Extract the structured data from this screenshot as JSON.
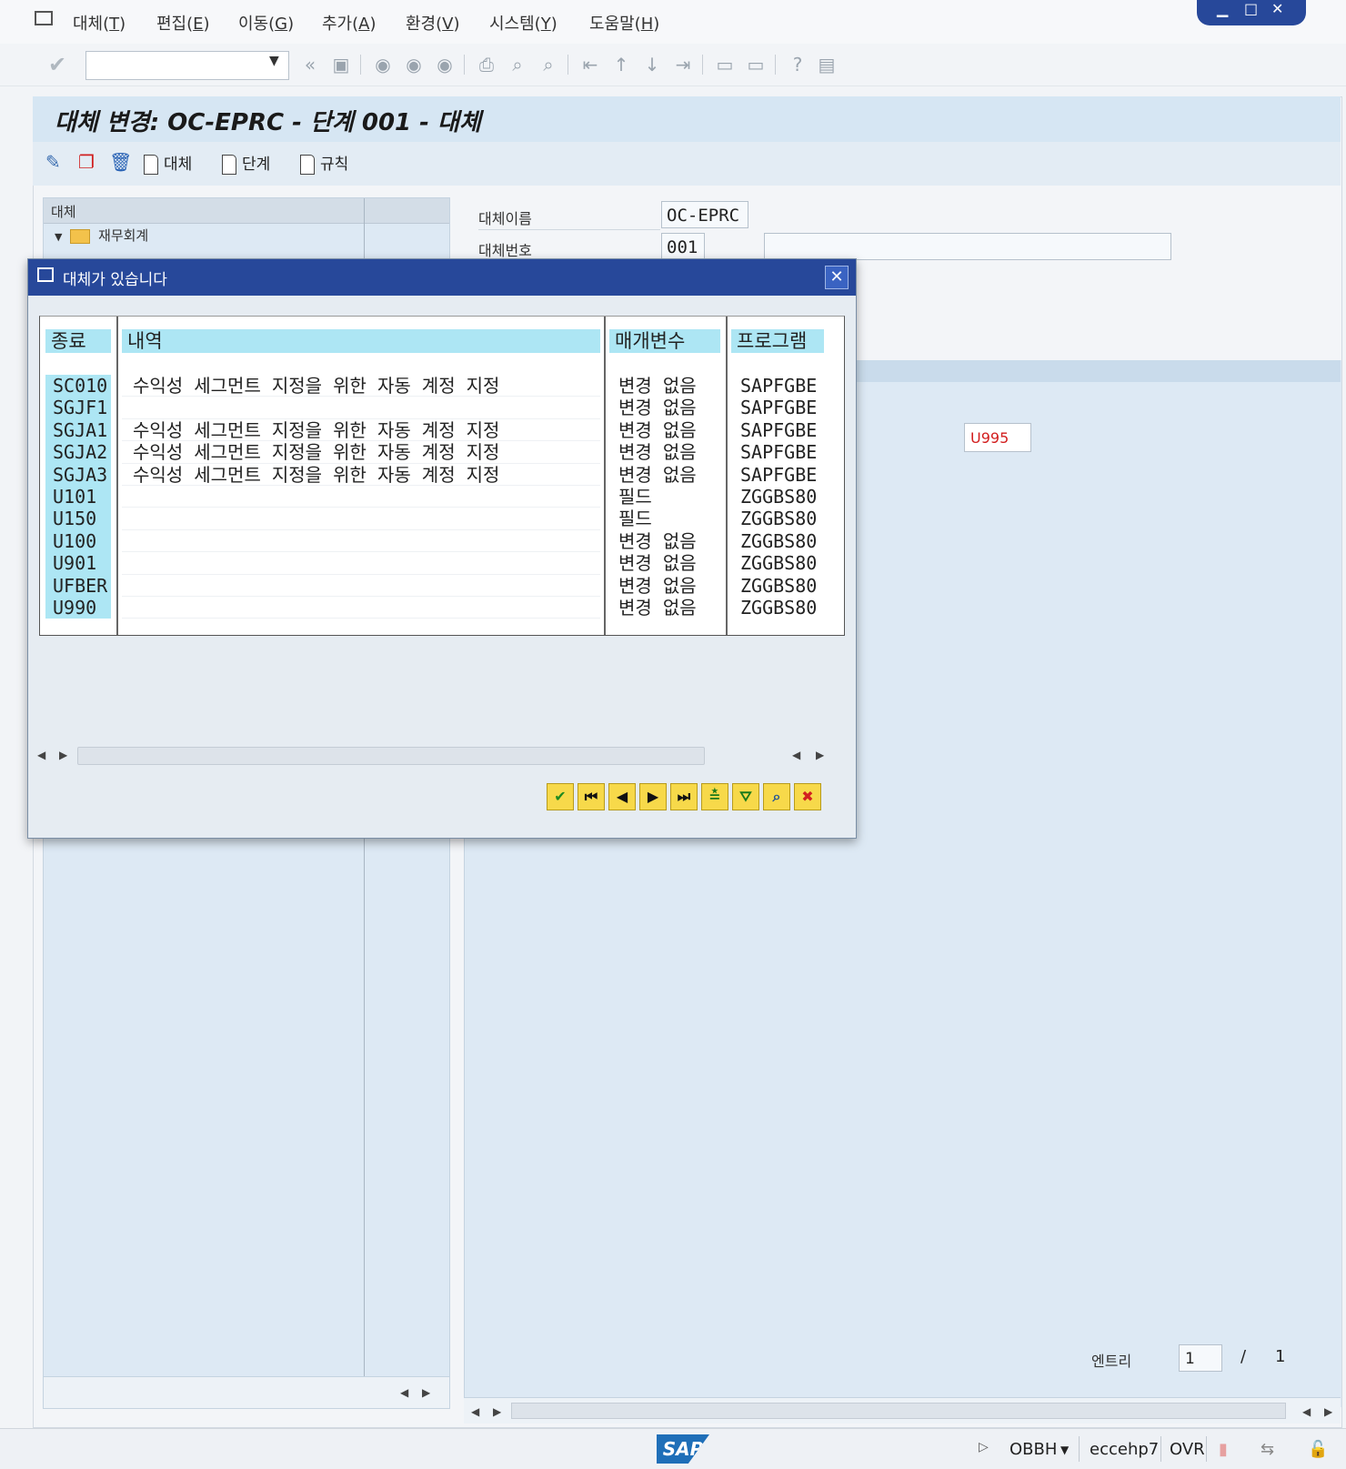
{
  "menubar": {
    "items": [
      {
        "label": "대체(",
        "key": "T",
        "end": ")"
      },
      {
        "label": "편집(",
        "key": "E",
        "end": ")"
      },
      {
        "label": "이동(",
        "key": "G",
        "end": ")"
      },
      {
        "label": "추가(",
        "key": "A",
        "end": ")"
      },
      {
        "label": "환경(",
        "key": "V",
        "end": ")"
      },
      {
        "label": "시스템(",
        "key": "Y",
        "end": ")"
      },
      {
        "label": "도움말(",
        "key": "H",
        "end": ")"
      }
    ]
  },
  "page": {
    "title": "대체 변경: OC-EPRC - 단계 001 - 대체"
  },
  "apptoolbar": {
    "substitution": "대체",
    "step": "단계",
    "rule": "규칙"
  },
  "tree": {
    "header": "대체",
    "root_node": "재무회계"
  },
  "form": {
    "name_label": "대체이름",
    "name_value": "OC-EPRC",
    "number_label": "대체번호",
    "number_value": "001",
    "number_desc": "",
    "field_value": "U995"
  },
  "entries": {
    "label": "엔트리",
    "current": "1",
    "separator": "/",
    "total": "1"
  },
  "statusbar": {
    "logo": "SAP",
    "transaction": "OBBH",
    "server": "eccehp7",
    "mode": "OVR"
  },
  "dialog": {
    "title": "대체가 있습니다",
    "columns": {
      "exit": "종료",
      "description": "내역",
      "parameter": "매개변수",
      "program": "프로그램"
    },
    "rows": [
      {
        "exit": "SC010",
        "desc": "수익성 세그먼트 지정을 위한 자동 계정 지정",
        "param": "변경 없음",
        "program": "SAPFGBE"
      },
      {
        "exit": "SGJF1",
        "desc": "",
        "param": "변경 없음",
        "program": "SAPFGBE"
      },
      {
        "exit": "SGJA1",
        "desc": "수익성 세그먼트 지정을 위한 자동 계정 지정",
        "param": "변경 없음",
        "program": "SAPFGBE"
      },
      {
        "exit": "SGJA2",
        "desc": "수익성 세그먼트 지정을 위한 자동 계정 지정",
        "param": "변경 없음",
        "program": "SAPFGBE"
      },
      {
        "exit": "SGJA3",
        "desc": "수익성 세그먼트 지정을 위한 자동 계정 지정",
        "param": "변경 없음",
        "program": "SAPFGBE"
      },
      {
        "exit": "U101",
        "desc": "",
        "param": "필드",
        "program": "ZGGBS80"
      },
      {
        "exit": "U150",
        "desc": "",
        "param": "필드",
        "program": "ZGGBS80"
      },
      {
        "exit": "U100",
        "desc": "",
        "param": "변경 없음",
        "program": "ZGGBS80"
      },
      {
        "exit": "U901",
        "desc": "",
        "param": "변경 없음",
        "program": "ZGGBS80"
      },
      {
        "exit": "UFBER",
        "desc": "",
        "param": "변경 없음",
        "program": "ZGGBS80"
      },
      {
        "exit": "U990",
        "desc": "",
        "param": "변경 없음",
        "program": "ZGGBS80"
      }
    ]
  },
  "colors": {
    "title_blue": "#27489a",
    "grid_header": "#ade6f4",
    "field_red": "#d21e1e",
    "button_yellow": "#f7d94a"
  }
}
